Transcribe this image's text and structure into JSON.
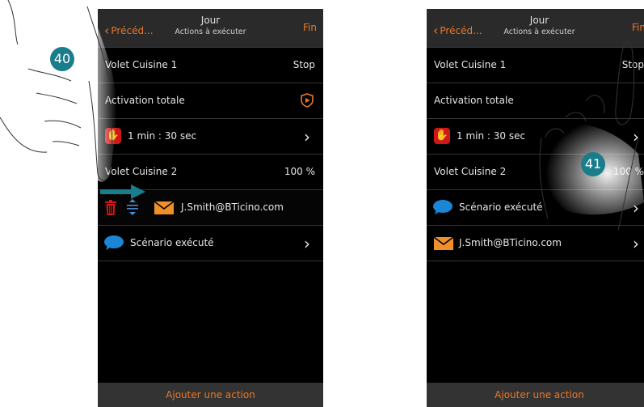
{
  "colors": {
    "accent": "#e8782a",
    "badge": "#1a7d8c",
    "danger": "#d01818",
    "info": "#1c86d6"
  },
  "left_screen": {
    "back_label": "Précéd...",
    "title": "Jour",
    "subtitle": "Actions à exécuter",
    "done_label": "Fin",
    "rows": [
      {
        "label": "Volet Cuisine 1",
        "value": "Stop"
      },
      {
        "label": "Activation totale",
        "icon": "shield-play-icon"
      },
      {
        "label": "1 min : 30 sec",
        "icon": "hand-icon"
      },
      {
        "label": "Volet Cuisine 2",
        "value": "100 %"
      },
      {
        "label": "J.Smith@BTicino.com",
        "icon": "mail-icon"
      },
      {
        "label": "Scénario exécuté",
        "icon": "bubble-icon"
      }
    ],
    "footer": "Ajouter une action",
    "step": "40"
  },
  "right_screen": {
    "back_label": "Précéd...",
    "title": "Jour",
    "subtitle": "Actions à exécuter",
    "done_label": "Fin",
    "rows": [
      {
        "label": "Volet Cuisine 1",
        "value": "Stop"
      },
      {
        "label": "Activation totale"
      },
      {
        "label": "1 min : 30 sec",
        "icon": "hand-icon"
      },
      {
        "label": "Volet Cuisine 2",
        "value": "100 %"
      },
      {
        "label": "Scénario exécuté",
        "icon": "bubble-icon"
      },
      {
        "label": "J.Smith@BTicino.com",
        "icon": "mail-icon"
      }
    ],
    "footer": "Ajouter une action",
    "step": "41"
  }
}
